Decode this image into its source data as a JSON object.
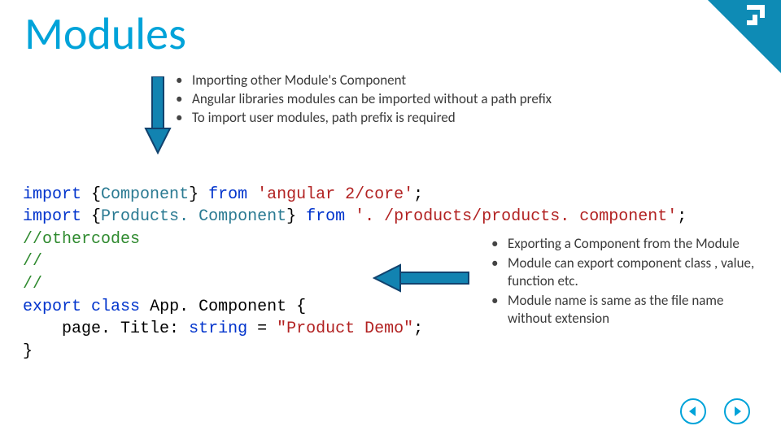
{
  "title": "Modules",
  "top_bullets": [
    "Importing other Module's Component",
    "Angular libraries modules can be imported without a path prefix",
    "To import user modules, path prefix is required"
  ],
  "code": {
    "import_kw": "import",
    "from_kw": "from",
    "export_kw": "export",
    "class_kw": "class",
    "lb": "{",
    "rb": "}",
    "component": "Component",
    "products_component": "Products. Component",
    "str1": "'angular 2/core'",
    "str2": "'. /products/products. component'",
    "semi": ";",
    "cmt1": "//othercodes",
    "cmt2": "//",
    "cmt3": "//",
    "app_component": "App. Component",
    "field": "page. Title",
    "colon": ":",
    "type_string": "string",
    "eq": "=",
    "demo": "\"Product Demo\""
  },
  "right_bullets": [
    "Exporting a Component from the Module",
    "Module can export component class , value, function etc.",
    "Module name is same as the file name without extension"
  ],
  "icons": {
    "arrow_down": "arrow-down-icon",
    "arrow_left": "arrow-left-icon",
    "prev": "prev-icon",
    "next": "next-icon",
    "logo": "corner-logo-icon"
  }
}
